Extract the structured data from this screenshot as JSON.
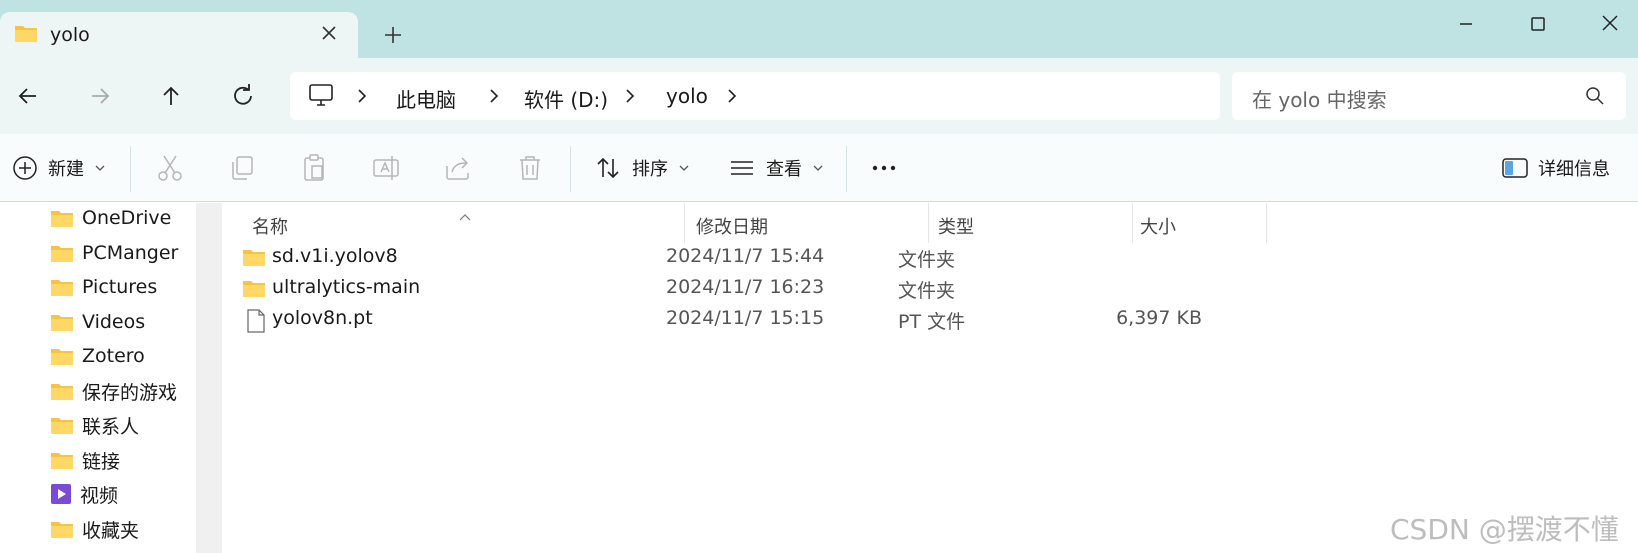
{
  "tab": {
    "title": "yolo"
  },
  "address": {
    "crumbs": [
      "此电脑",
      "软件 (D:)",
      "yolo"
    ]
  },
  "search": {
    "placeholder": "在 yolo 中搜索"
  },
  "toolbar": {
    "new_label": "新建",
    "sort_label": "排序",
    "view_label": "查看",
    "details_label": "详细信息"
  },
  "sidebar": {
    "items": [
      {
        "label": "OneDrive",
        "icon": "folder-icon"
      },
      {
        "label": "PCManger",
        "icon": "folder-icon"
      },
      {
        "label": "Pictures",
        "icon": "folder-icon"
      },
      {
        "label": "Videos",
        "icon": "folder-icon"
      },
      {
        "label": "Zotero",
        "icon": "folder-icon"
      },
      {
        "label": "保存的游戏",
        "icon": "folder-icon"
      },
      {
        "label": "联系人",
        "icon": "folder-icon"
      },
      {
        "label": "链接",
        "icon": "folder-icon"
      },
      {
        "label": "视频",
        "icon": "video-folder-icon"
      },
      {
        "label": "收藏夹",
        "icon": "folder-icon"
      }
    ]
  },
  "table": {
    "headers": [
      "名称",
      "修改日期",
      "类型",
      "大小"
    ],
    "rows": [
      {
        "name": "sd.v1i.yolov8",
        "date": "2024/11/7 15:44",
        "type": "文件夹",
        "size": "",
        "icon": "folder-icon"
      },
      {
        "name": "ultralytics-main",
        "date": "2024/11/7 16:23",
        "type": "文件夹",
        "size": "",
        "icon": "folder-icon"
      },
      {
        "name": "yolov8n.pt",
        "date": "2024/11/7 15:15",
        "type": "PT 文件",
        "size": "6,397 KB",
        "icon": "file-icon"
      }
    ]
  },
  "watermark": "CSDN @摆渡不懂",
  "colors": {
    "titlebar_bg": "#bfe3e3",
    "nav_bg": "#eef5f5",
    "folder_yellow": "#f5c542"
  }
}
